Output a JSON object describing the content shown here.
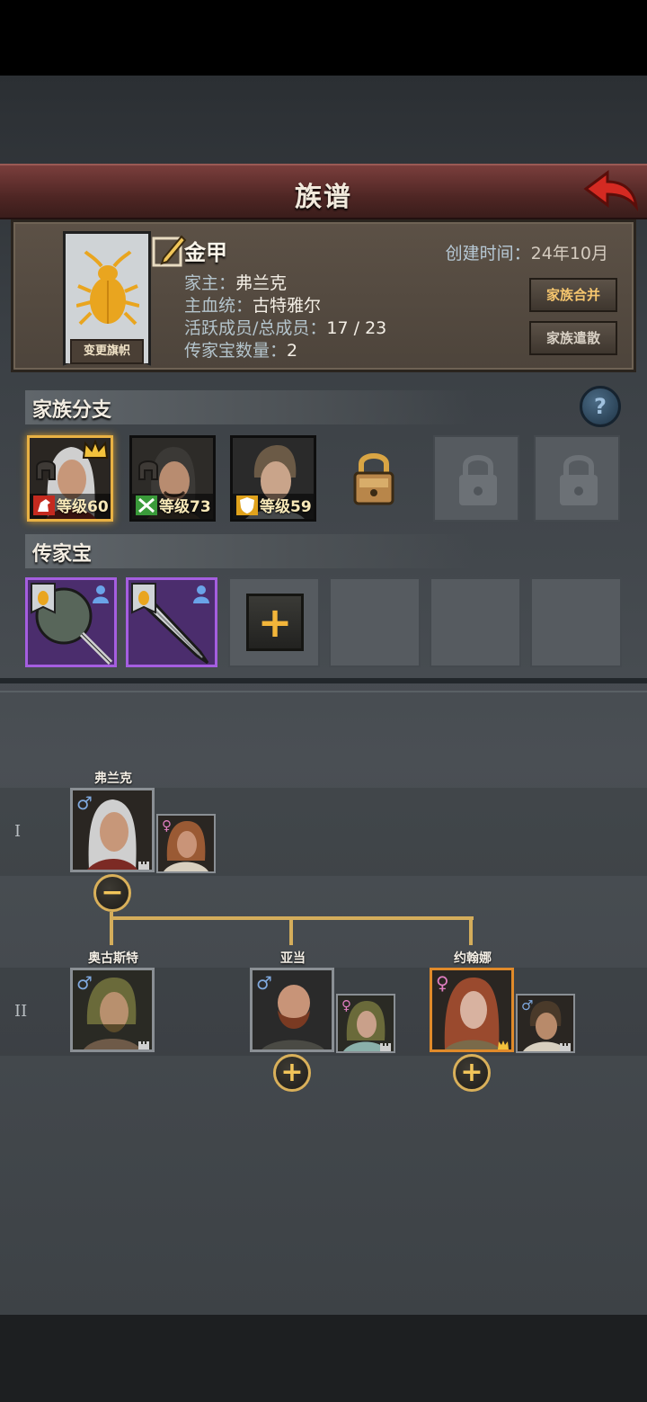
{
  "header": {
    "title": "族谱"
  },
  "family": {
    "name": "金甲",
    "created_label": "创建时间：",
    "created_value": "24年10月",
    "head_label": "家主：",
    "head_value": "弗兰克",
    "bloodline_label": "主血统：",
    "bloodline_value": "古特雅尔",
    "members_label": "活跃成员/总成员：",
    "members_value": "17 / 23",
    "heirloom_count_label": "传家宝数量：",
    "heirloom_count_value": "2",
    "change_banner_label": "变更旗帜",
    "merge_label": "家族合并",
    "disband_label": "家族遣散"
  },
  "branches": {
    "title": "家族分支",
    "members": [
      {
        "level": "等级60",
        "type_icon": "horse-icon",
        "crown": true,
        "selected": true
      },
      {
        "level": "等级73",
        "type_icon": "crossed-swords-icon",
        "crown": false,
        "selected": false
      },
      {
        "level": "等级59",
        "type_icon": "shield-icon",
        "crown": false,
        "selected": false
      }
    ],
    "locked_slots": 3
  },
  "heirlooms": {
    "title": "传家宝",
    "items": [
      "mace-icon",
      "sword-icon"
    ],
    "empty_slots": 3
  },
  "tree": {
    "gen1_label": "I",
    "gen2_label": "II",
    "gen1": {
      "name": "弗兰克",
      "gender": "♂",
      "spouse_gender": "♀"
    },
    "gen2": [
      {
        "name": "奥古斯特",
        "gender": "♂"
      },
      {
        "name": "亚当",
        "gender": "♂",
        "spouse_gender": "♀"
      },
      {
        "name": "约翰娜",
        "gender": "♀",
        "spouse_gender": "♂"
      }
    ],
    "collapse_symbol": "−",
    "expand_symbol": "+"
  },
  "colors": {
    "title_band": "#5c2d2b",
    "gold_accent": "#d4ad5b",
    "selected_border": "#e8b144",
    "heirloom_purple": "#a55ee0",
    "male_blue": "#7fa8dd",
    "female_pink": "#e07ec1"
  }
}
